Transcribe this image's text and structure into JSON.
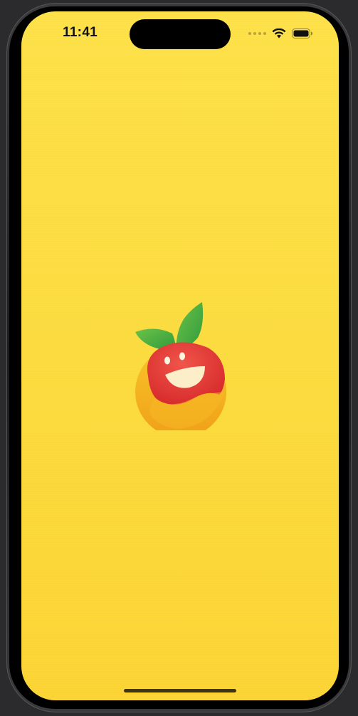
{
  "status_bar": {
    "time": "11:41",
    "signal_icon": "signal-dots-icon",
    "wifi_icon": "wifi-icon",
    "battery_icon": "battery-icon"
  },
  "splash": {
    "logo_icon": "fruit-mascot-logo-icon",
    "background_color": "#fbd93b"
  },
  "home_indicator": {
    "icon": "home-indicator"
  }
}
